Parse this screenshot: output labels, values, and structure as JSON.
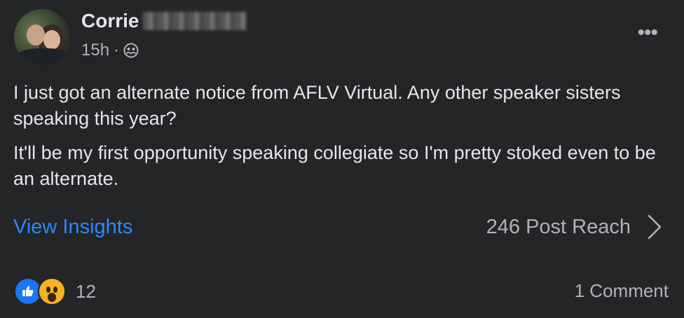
{
  "post": {
    "author": "Corrie",
    "time": "15h",
    "separator": "·",
    "audience_icon": "group-icon",
    "paragraphs": [
      "I just got an alternate notice from AFLV Virtual.  Any other speaker sisters speaking this year?",
      "It'll be my first opportunity speaking collegiate so I'm pretty stoked even to be an alternate."
    ],
    "more_icon": "more-options-icon",
    "more_glyph": "•••"
  },
  "insights": {
    "link_label": "View Insights",
    "reach_label": "246 Post Reach"
  },
  "footer": {
    "reaction_icons": [
      "like-icon",
      "wow-icon"
    ],
    "reaction_count": "12",
    "comment_label": "1 Comment"
  },
  "colors": {
    "background": "#242526",
    "text_primary": "#e4e6eb",
    "text_secondary": "#b0b3b8",
    "link": "#2d88ff",
    "like": "#1877f2",
    "wow": "#f7b125"
  }
}
